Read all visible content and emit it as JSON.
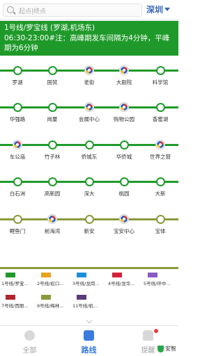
{
  "search": {
    "placeholder": "起点|终点"
  },
  "city": {
    "label": "深圳"
  },
  "banner": {
    "title": "1号线/罗宝线 (罗湖,机场东)",
    "info": "06:30-23:00#注：高峰期发车间隔为4分钟，平峰期为6分钟"
  },
  "rows": [
    {
      "stations": [
        "罗湖",
        "国贸",
        "老街",
        "大剧院",
        "科学馆"
      ],
      "transfer": [
        false,
        false,
        true,
        true,
        false
      ]
    },
    {
      "stations": [
        "华强路",
        "岗厦",
        "会展中心",
        "购物公园",
        "香蜜湖"
      ],
      "transfer": [
        false,
        false,
        true,
        true,
        false
      ]
    },
    {
      "stations": [
        "车公庙",
        "竹子林",
        "侨城东",
        "华侨城",
        "世界之窗"
      ],
      "transfer": [
        true,
        false,
        false,
        false,
        true
      ]
    },
    {
      "stations": [
        "白石洲",
        "高新园",
        "深大",
        "桃园",
        "大新"
      ],
      "transfer": [
        false,
        false,
        false,
        false,
        false
      ]
    },
    {
      "stations": [
        "鲤鱼门",
        "前海湾",
        "新安",
        "宝安中心",
        "宝体"
      ],
      "transfer": [
        false,
        true,
        false,
        true,
        false
      ]
    }
  ],
  "lines": [
    {
      "label": "1号线/罗宝...",
      "color": "#1f9a2a"
    },
    {
      "label": "2号线/蛇口...",
      "color": "#e9a31f"
    },
    {
      "label": "3号线/龙岗...",
      "color": "#1e8fd6"
    },
    {
      "label": "4号线/龙华...",
      "color": "#d4203a"
    },
    {
      "label": "5号线/环中...",
      "color": "#8a5ac6"
    },
    {
      "label": "7号线/西丽...",
      "color": "#b2252e"
    },
    {
      "label": "9号线/梅林...",
      "color": "#8a9a3a"
    },
    {
      "label": "11号线/机...",
      "color": "#5a3a7a"
    }
  ],
  "tabs": [
    {
      "label": "全部"
    },
    {
      "label": "路线"
    },
    {
      "label": "提醒"
    }
  ],
  "safe_label": "安智"
}
